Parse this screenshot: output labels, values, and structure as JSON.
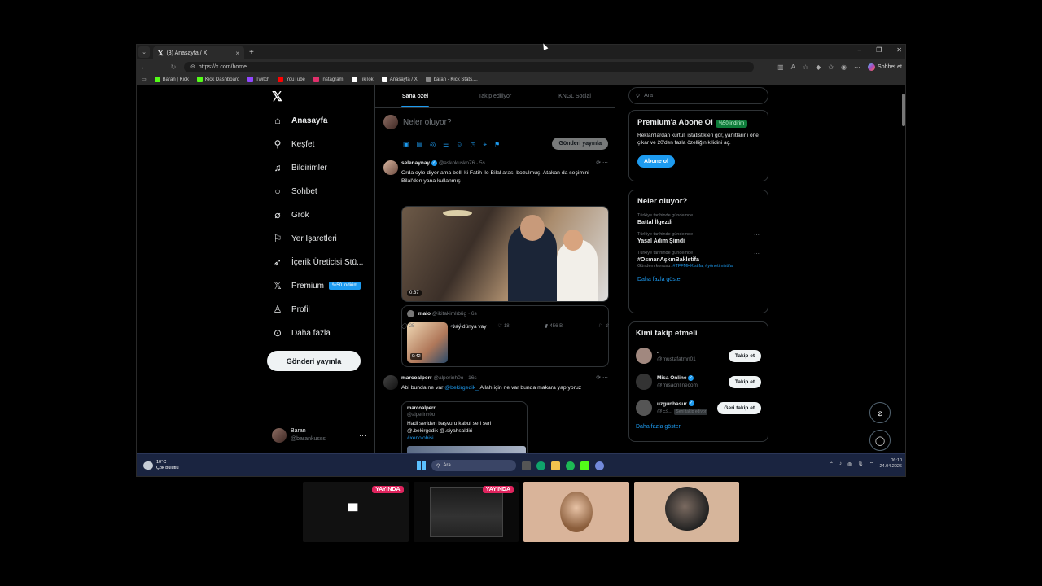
{
  "browser": {
    "tab_title": "(3) Anasayfa / X",
    "url": "https://x.com/home",
    "copilot_label": "Sohbet et",
    "bookmarks": [
      {
        "label": "Baran | Kick",
        "color": "#53fc18"
      },
      {
        "label": "Kick Dashboard",
        "color": "#53fc18"
      },
      {
        "label": "Twitch",
        "color": "#9146ff"
      },
      {
        "label": "YouTube",
        "color": "#ff0000"
      },
      {
        "label": "Instagram",
        "color": "#e1306c"
      },
      {
        "label": "TikTok",
        "color": "#ffffff"
      },
      {
        "label": "Anasayfa / X",
        "color": "#ffffff"
      },
      {
        "label": "baran - Kick Stats,...",
        "color": "#888888"
      }
    ]
  },
  "nav": {
    "items": [
      {
        "label": "Anasayfa",
        "icon": "home-icon",
        "glyph": "⌂"
      },
      {
        "label": "Keşfet",
        "icon": "search-icon",
        "glyph": "⚲"
      },
      {
        "label": "Bildirimler",
        "icon": "bell-icon",
        "glyph": "🔔︎"
      },
      {
        "label": "Sohbet",
        "icon": "chat-icon",
        "glyph": "◯"
      },
      {
        "label": "Grok",
        "icon": "grok-icon",
        "glyph": "⌀"
      },
      {
        "label": "Yer İşaretleri",
        "icon": "bookmark-icon",
        "glyph": "⚐"
      },
      {
        "label": "İçerik Üreticisi Stü...",
        "icon": "rocket-icon",
        "glyph": "➶"
      },
      {
        "label": "Premium",
        "icon": "x-icon",
        "glyph": "𝕏"
      },
      {
        "label": "Profil",
        "icon": "person-icon",
        "glyph": "♙"
      },
      {
        "label": "Daha fazla",
        "icon": "more-icon",
        "glyph": "⋯"
      }
    ],
    "premium_badge": "%50 indirim",
    "post_button": "Gönderi yayınla",
    "profile_name": "Baran",
    "profile_handle": "@barankusss"
  },
  "feed": {
    "tabs": [
      "Sana özel",
      "Takip ediliyor",
      "KNGL Social"
    ],
    "composer_placeholder": "Neler oluyor?",
    "composer_button": "Gönderi yayınla",
    "tweet1": {
      "name": "selenaynay",
      "handle": "@askokusko76 · 5s",
      "text": "Orda oyle diyor ama belli ki Fatih ile Bilal arası bozulmuş. Atakan da seçimini Bilal'den yana kullanmış",
      "video_duration": "0:37",
      "quote_name": "malo",
      "quote_handle": "@ikitakimlıbüg · 6s",
      "quote_text": "vay dünya vay",
      "quote_duration": "0:42",
      "replies": "25",
      "retweets": "11",
      "likes": "18",
      "views": "456 B"
    },
    "tweet2": {
      "name": "marcoalperr",
      "handle": "@alperinh0o · 16s",
      "text_before": "Abi bunda ne var ",
      "mention": "@bekirgedik_",
      "text_after": " Allah için ne var bunda makara yapıyoruz",
      "quote_name": "marcoalperr",
      "quote_handle": "@alperinh0o",
      "quote_line1": "Hadi seriden başvuru kabul seri seri",
      "quote_line2": "@.bekirgedik @.siyahsaldiri",
      "quote_hashtag": "#xenolobisi"
    }
  },
  "right": {
    "search_placeholder": "Ara",
    "premium_title": "Premium'a Abone Ol",
    "premium_badge": "%50 indirim",
    "premium_text": "Reklamlardan kurtul, istatistikleri gör, yanıtlarını öne çıkar ve 20'den fazla özelliğin kilidini aç.",
    "premium_button": "Abone ol",
    "trends_title": "Neler oluyor?",
    "trends": [
      {
        "context": "Türkiye tarihinde gündemde",
        "name": "Battal İlgezdi",
        "sub": ""
      },
      {
        "context": "Türkiye tarihinde gündemde",
        "name": "Yasal Adım Şimdi",
        "sub": ""
      },
      {
        "context": "Türkiye tarihinde gündemde",
        "name": "#OsmanAşkınBakİstifa",
        "sub_prefix": "Gündem konusu:",
        "sub_links": "#TFFMHKistifa, #yönetimistifa"
      }
    ],
    "trends_more": "Daha fazla göster",
    "follow_title": "Kimi takip etmeli",
    "follow": [
      {
        "name": ".",
        "handle": "@mustafatmn01",
        "button": "Takip et",
        "color": "#a1887f"
      },
      {
        "name": "Misa Online",
        "handle": "@misaonlinecom",
        "button": "Takip et",
        "color": "#333333"
      },
      {
        "name": "uzgunbasur",
        "handle": "@Es...",
        "tag": "Seni takip ediyor",
        "button": "Geri takip et",
        "color": "#555555"
      }
    ],
    "follow_more": "Daha fazla göster"
  },
  "taskbar": {
    "temp": "10°C",
    "weather": "Çok bulutlu",
    "search": "Ara",
    "time": "06:10",
    "date": "24.04.2026"
  },
  "streams": {
    "live_label": "YAYINDA"
  }
}
